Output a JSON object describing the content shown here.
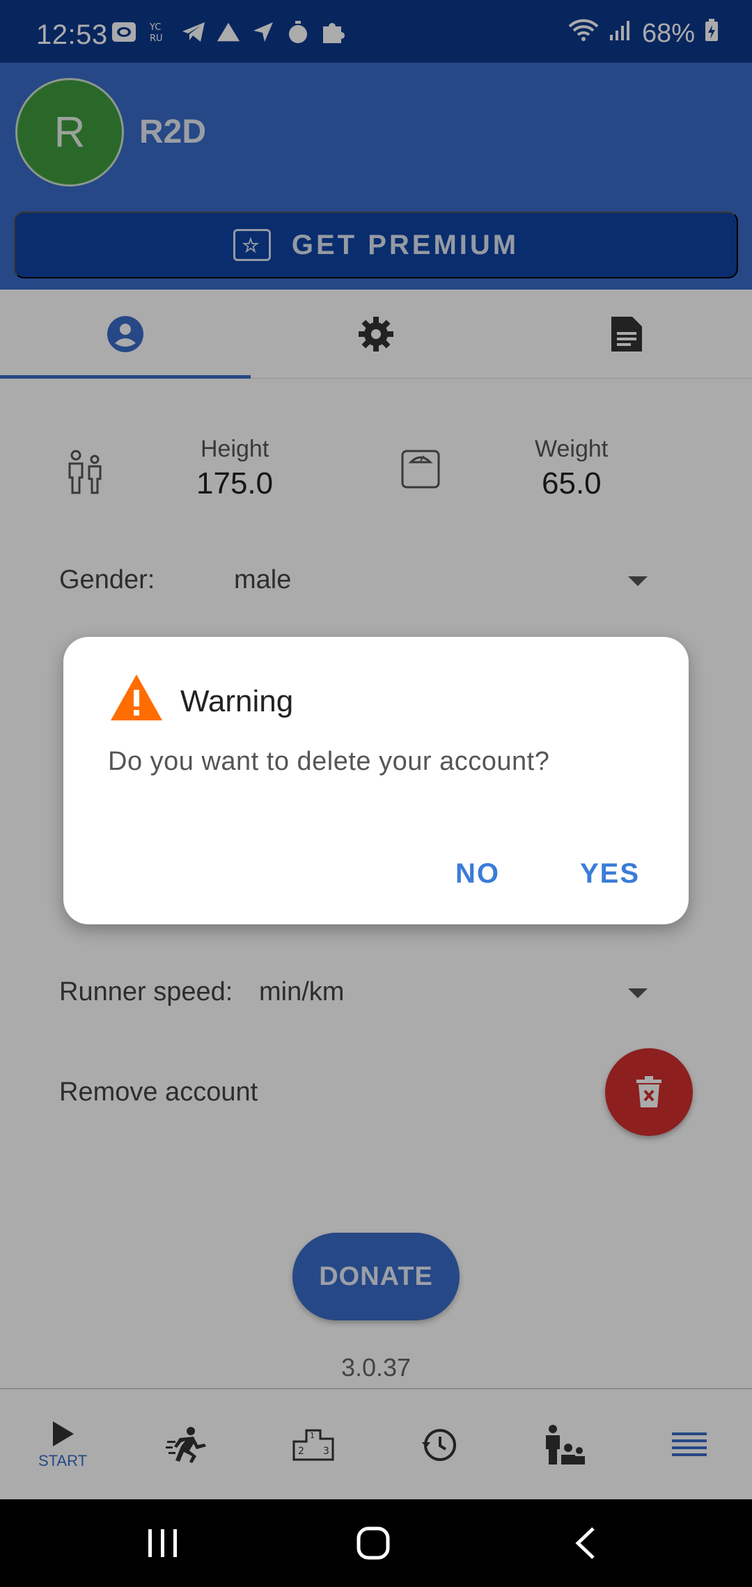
{
  "status_bar": {
    "time": "12:53",
    "battery": "68%"
  },
  "header": {
    "avatar_letter": "R",
    "username": "R2D"
  },
  "premium": {
    "label": "GET PREMIUM"
  },
  "tabs": [
    {
      "name": "profile",
      "icon": "account-circle-icon",
      "selected": true
    },
    {
      "name": "settings",
      "icon": "gear-icon",
      "selected": false
    },
    {
      "name": "document",
      "icon": "document-icon",
      "selected": false
    }
  ],
  "profile": {
    "height_label": "Height",
    "height_value": "175.0",
    "weight_label": "Weight",
    "weight_value": "65.0",
    "gender_label": "Gender:",
    "gender_value": "male",
    "speed_label": "Runner speed:",
    "speed_value": "min/km",
    "remove_label": "Remove account"
  },
  "donate_label": "DONATE",
  "version": "3.0.37",
  "bottom_nav": {
    "start_label": "START",
    "items": [
      "play-icon",
      "runner-icon",
      "podium-icon",
      "history-icon",
      "coach-icon",
      "menu-icon"
    ]
  },
  "dialog": {
    "title": "Warning",
    "message": "Do you want to delete your account?",
    "no_label": "NO",
    "yes_label": "YES"
  },
  "colors": {
    "primary": "#3a6cc8",
    "status_bar": "#0d3a8c",
    "premium": "#0f43a5",
    "avatar": "#3f9b3f",
    "danger": "#d32f2f",
    "warning": "#ff6d00",
    "dialog_button": "#3a7cd8"
  }
}
